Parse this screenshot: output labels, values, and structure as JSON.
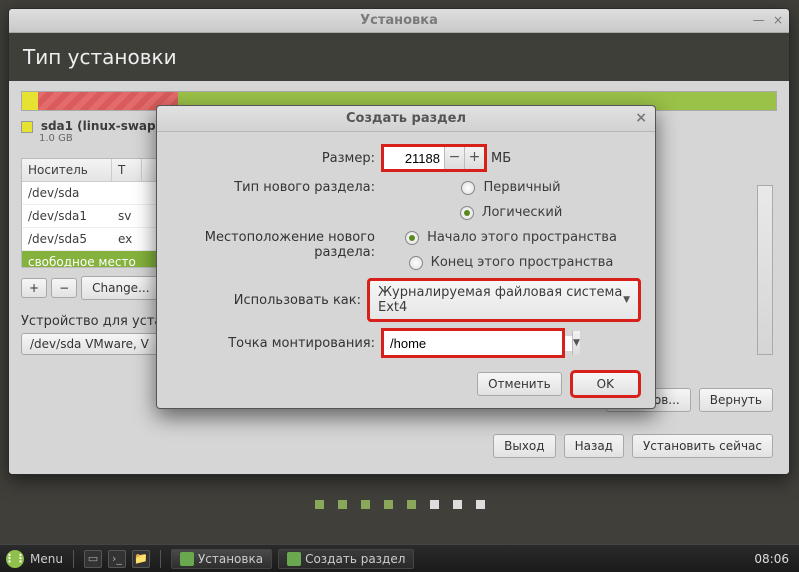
{
  "window": {
    "title": "Установка"
  },
  "header": {
    "title": "Тип установки"
  },
  "legend": {
    "sda1": "sda1 (linux-swap)",
    "size": "1.0 GB"
  },
  "devtable": {
    "col1": "Носитель",
    "col2": "Т",
    "rows": [
      "/dev/sda",
      "  /dev/sda1",
      "  /dev/sda5"
    ],
    "row1_t": "sv",
    "row2_t": "ex",
    "free": "свободное место"
  },
  "toolbar": {
    "plus": "+",
    "minus": "−",
    "change": "Change..."
  },
  "boot_label": "Устройство для устано",
  "boot_combo": "/dev/sda  VMware, V",
  "buttons": {
    "partitions": "азделов...",
    "revert": "Вернуть",
    "exit": "Выход",
    "back": "Назад",
    "install": "Установить сейчас"
  },
  "dialog": {
    "title": "Создать раздел",
    "size_label": "Размер:",
    "size_value": "21188",
    "unit": "МБ",
    "type_label": "Тип нового раздела:",
    "type_primary": "Первичный",
    "type_logical": "Логический",
    "loc_label": "Местоположение нового раздела:",
    "loc_begin": "Начало этого пространства",
    "loc_end": "Конец этого пространства",
    "use_label": "Использовать как:",
    "use_value": "Журналируемая файловая система Ext4",
    "mount_label": "Точка монтирования:",
    "mount_value": "/home",
    "cancel": "Отменить",
    "ok": "OK"
  },
  "taskbar": {
    "menu": "Menu",
    "task1": "Установка",
    "task2": "Создать раздел",
    "clock": "08:06"
  }
}
